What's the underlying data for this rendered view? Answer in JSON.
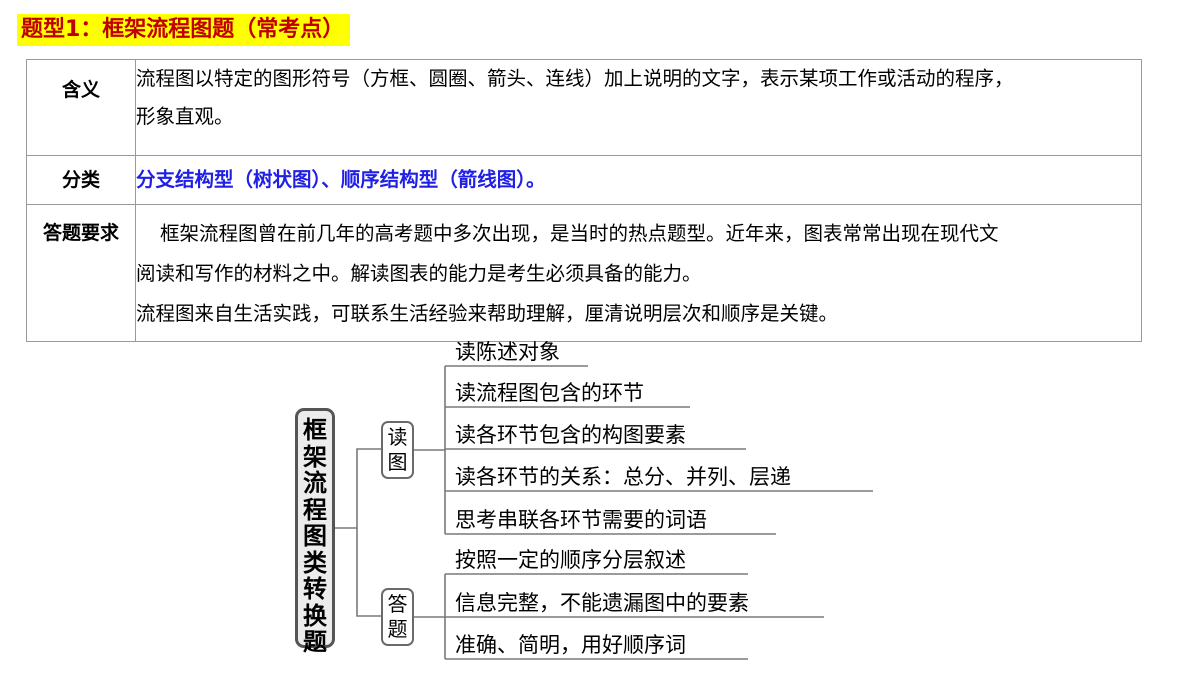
{
  "title": "题型1：框架流程图题（常考点）",
  "table": {
    "rows": [
      {
        "label": "含义",
        "lines": [
          "流程图以特定的图形符号（方框、圆圈、箭头、连线）加上说明的文字，表示某项工作或活动的程序，",
          "形象直观。"
        ]
      },
      {
        "label": "分类",
        "lines": [
          "分支结构型（树状图）、顺序结构型（箭线图）。"
        ]
      },
      {
        "label": "答题要求",
        "lines": [
          "框架流程图曾在前几年的高考题中多次出现，是当时的热点题型。近年来，图表常常出现在现代文",
          "阅读和写作的材料之中。解读图表的能力是考生必须具备的能力。",
          "流程图来自生活实践，可联系生活经验来帮助理解，厘清说明层次和顺序是关键。"
        ]
      }
    ]
  },
  "diagram": {
    "root": "框架流程图类转换题",
    "branches": [
      {
        "label": "读图",
        "items": [
          "读陈述对象",
          "读流程图包含的环节",
          "读各环节包含的构图要素",
          "读各环节的关系：总分、并列、层递",
          "思考串联各环节需要的词语"
        ]
      },
      {
        "label": "答题",
        "items": [
          "按照一定的顺序分层叙述",
          "信息完整，不能遗漏图中的要素",
          "准确、简明，用好顺序词"
        ]
      }
    ]
  },
  "colors": {
    "title_bg": "#ffff00",
    "title_text": "#c00000",
    "category_text": "#1f1fe6"
  }
}
